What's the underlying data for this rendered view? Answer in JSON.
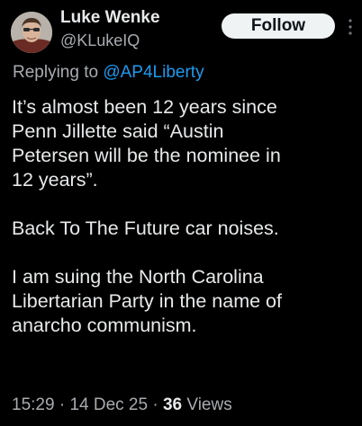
{
  "author": {
    "display_name": "Luke Wenke",
    "handle": "@KLukeIQ"
  },
  "actions": {
    "follow_label": "Follow"
  },
  "reply": {
    "prefix": "Replying to ",
    "mention": "@AP4Liberty"
  },
  "tweet": {
    "paragraphs": [
      "It’s almost been 12 years since\nPenn Jillette said “Austin\nPetersen will be the nominee in\n12 years”.",
      "Back To The Future car noises.",
      "I am suing the North Carolina\nLibertarian Party in the name of\nanarcho communism."
    ]
  },
  "meta": {
    "time": "15:29",
    "separator": " · ",
    "date": "14 Dec 25",
    "views_count": "36",
    "views_label": " Views"
  },
  "icons": {
    "more": "more-options-icon",
    "avatar": "profile-avatar"
  },
  "colors": {
    "background": "#000000",
    "text_primary": "#e7e9ea",
    "text_secondary": "#a8acb0",
    "accent": "#1d9bf0",
    "follow_bg": "#eff3f4"
  }
}
